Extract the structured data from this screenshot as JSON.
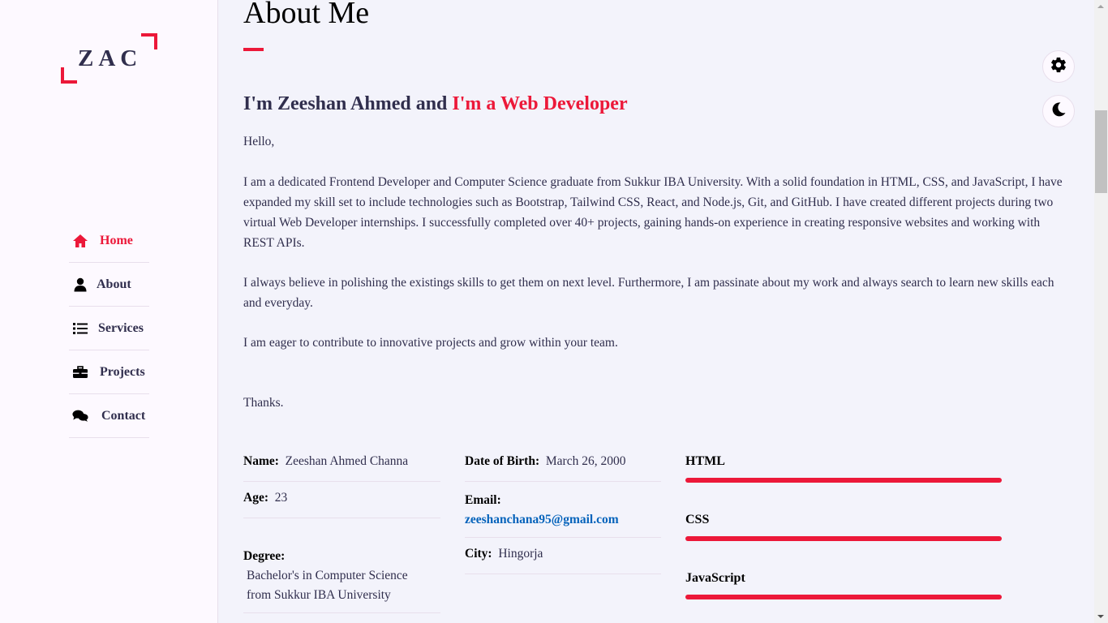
{
  "logo": {
    "text": "ZAC"
  },
  "nav": [
    {
      "label": "Home",
      "icon": "home-icon",
      "active": true
    },
    {
      "label": "About",
      "icon": "user-icon",
      "active": false
    },
    {
      "label": "Services",
      "icon": "list-icon",
      "active": false
    },
    {
      "label": "Projects",
      "icon": "briefcase-icon",
      "active": false
    },
    {
      "label": "Contact",
      "icon": "comments-icon",
      "active": false
    }
  ],
  "about": {
    "title": "About Me",
    "intro_prefix": "I'm Zeeshan Ahmed and ",
    "intro_accent": "I'm a Web Developer",
    "greeting": "Hello,",
    "para1": "I am a dedicated Frontend Developer and Computer Science graduate from Sukkur IBA University. With a solid foundation in HTML, CSS, and JavaScript, I have expanded my skill set to include technologies such as Bootstrap, Tailwind CSS, React, and Node.js, Git, and GitHub. I have created different projects during two virtual Web Developer internships. I successfully completed over 40+ projects, gaining hands-on experience in creating responsive websites and working with REST APIs.",
    "para2": "I always believe in polishing the existings skills to get them on next level. Furthermore, I am passinate about my work and always search to learn new skills each and everyday.",
    "para3": "I am eager to contribute to innovative projects and grow within your team.",
    "thanks": "Thanks."
  },
  "info": {
    "name_label": "Name:",
    "name_value": "Zeeshan Ahmed Channa",
    "age_label": "Age:",
    "age_value": "23",
    "degree_label": "Degree:",
    "degree_value": "Bachelor's in Computer Science from Sukkur IBA University",
    "dob_label": "Date of Birth:",
    "dob_value": "March 26, 2000",
    "email_label": "Email:",
    "email_value": "zeeshanchana95@gmail.com",
    "city_label": "City:",
    "city_value": "Hingorja"
  },
  "skills": [
    {
      "name": "HTML",
      "level": 100
    },
    {
      "name": "CSS",
      "level": 100
    },
    {
      "name": "JavaScript",
      "level": 100
    }
  ],
  "controls": {
    "settings_icon": "gear-icon",
    "theme_icon": "moon-icon"
  },
  "colors": {
    "accent": "#ec1839",
    "text": "#302e4d",
    "link": "#0563bb",
    "background": "#f3f3fb"
  }
}
